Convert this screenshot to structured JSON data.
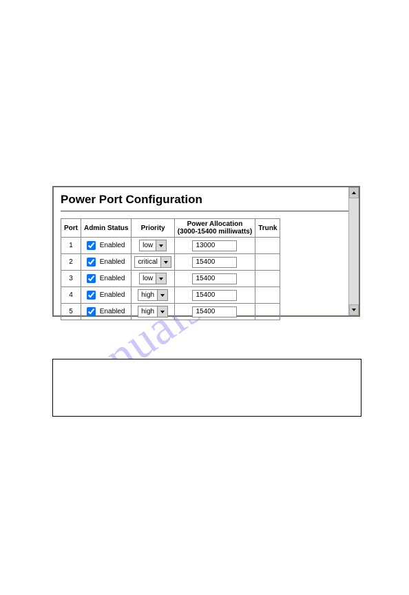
{
  "watermark": "manualshive.com",
  "title": "Power Port Configuration",
  "headers": {
    "port": "Port",
    "admin": "Admin Status",
    "priority": "Priority",
    "alloc_line1": "Power Allocation",
    "alloc_line2": "(3000-15400 milliwatts)",
    "trunk": "Trunk"
  },
  "enabled_label": "Enabled",
  "rows": [
    {
      "port": "1",
      "enabled": true,
      "priority": "low",
      "alloc": "13000",
      "trunk": ""
    },
    {
      "port": "2",
      "enabled": true,
      "priority": "critical",
      "alloc": "15400",
      "trunk": ""
    },
    {
      "port": "3",
      "enabled": true,
      "priority": "low",
      "alloc": "15400",
      "trunk": ""
    },
    {
      "port": "4",
      "enabled": true,
      "priority": "high",
      "alloc": "15400",
      "trunk": ""
    },
    {
      "port": "5",
      "enabled": true,
      "priority": "high",
      "alloc": "15400",
      "trunk": ""
    }
  ]
}
